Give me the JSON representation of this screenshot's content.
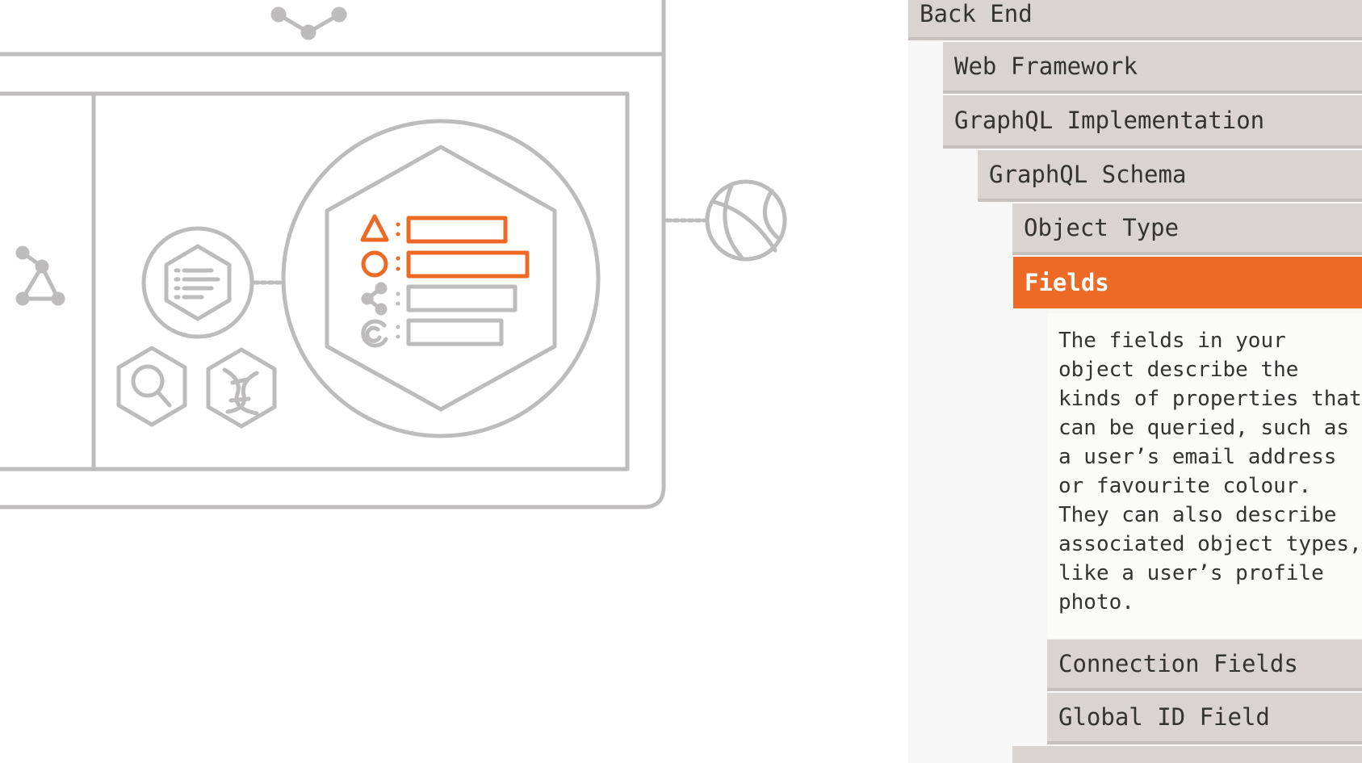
{
  "sidebar": {
    "items": [
      {
        "label": "Back End"
      },
      {
        "label": "Web Framework"
      },
      {
        "label": "GraphQL Implementation"
      },
      {
        "label": "GraphQL Schema"
      },
      {
        "label": "Object Type"
      },
      {
        "label": "Fields",
        "active": true
      },
      {
        "label": "Connection Fields"
      },
      {
        "label": "Global ID Field"
      }
    ],
    "description": "The fields in your\nobject describe the\nkinds of properties that\ncan be queried, such as\na user’s email address\nor favourite colour.\nThey can also describe\nassociated object types,\nlike a user’s profile\nphoto."
  },
  "colors": {
    "accent": "#ec6a25",
    "diagram_stroke": "#bdbbbb",
    "nav_background": "#d9d4d1"
  },
  "icons": [
    "graph-triangle-icon",
    "document-list-hex-icon",
    "search-hex-icon",
    "dna-hex-icon",
    "triangle-field-icon",
    "circle-field-icon",
    "share-field-icon",
    "fingerprint-field-icon",
    "globe-icon",
    "graphql-logo-icon"
  ]
}
